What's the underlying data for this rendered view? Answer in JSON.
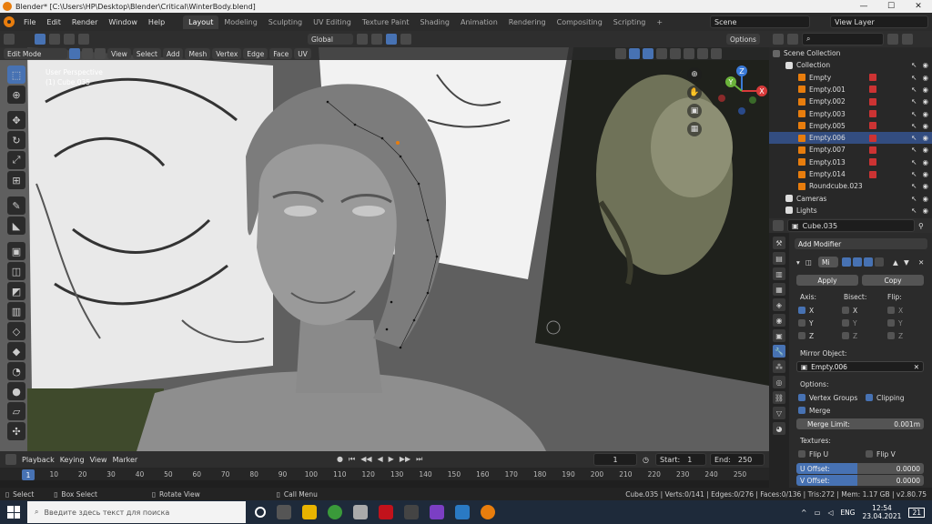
{
  "window": {
    "title": "Blender* [C:\\Users\\HP\\Desktop\\Blender\\Critical\\WinterBody.blend]",
    "controls": [
      "—",
      "☐",
      "✕"
    ]
  },
  "menubar": {
    "menus": [
      "File",
      "Edit",
      "Render",
      "Window",
      "Help"
    ],
    "workspaces": [
      "Layout",
      "Modeling",
      "Sculpting",
      "UV Editing",
      "Texture Paint",
      "Shading",
      "Animation",
      "Rendering",
      "Compositing",
      "Scripting"
    ],
    "active_workspace": "Layout",
    "add_tab": "+",
    "scene": "Scene",
    "view_layer": "View Layer"
  },
  "viewport_header": {
    "transform_orientation": "Global",
    "options": "Options",
    "mode": "Edit Mode",
    "menus": [
      "View",
      "Select",
      "Add",
      "Mesh",
      "Vertex",
      "Edge",
      "Face",
      "UV"
    ]
  },
  "viewport": {
    "perspective": "User Perspective",
    "object": "(1) Cube.035"
  },
  "gizmo": {
    "x": "X",
    "y": "Y",
    "z": "Z"
  },
  "timeline": {
    "menus": [
      "Playback",
      "Keying",
      "View",
      "Marker"
    ],
    "current_frame": "1",
    "start_label": "Start:",
    "start": "1",
    "end_label": "End:",
    "end": "250",
    "frames": [
      "1",
      "10",
      "20",
      "30",
      "40",
      "50",
      "60",
      "70",
      "80",
      "90",
      "100",
      "110",
      "120",
      "130",
      "140",
      "150",
      "160",
      "170",
      "180",
      "190",
      "200",
      "210",
      "220",
      "230",
      "240",
      "250"
    ]
  },
  "statusbar": {
    "select": "Select",
    "box_select": "Box Select",
    "rotate_view": "Rotate View",
    "call_menu": "Call Menu",
    "stats": "Cube.035 | Verts:0/141 | Edges:0/276 | Faces:0/136 | Tris:272 | Mem: 1.17 GB | v2.80.75"
  },
  "outliner": {
    "root": "Scene Collection",
    "items": [
      {
        "label": "Collection",
        "level": 1,
        "selected": false,
        "type": "collection"
      },
      {
        "label": "Empty",
        "level": 2,
        "selected": false,
        "type": "empty"
      },
      {
        "label": "Empty.001",
        "level": 2,
        "selected": false,
        "type": "empty"
      },
      {
        "label": "Empty.002",
        "level": 2,
        "selected": false,
        "type": "empty"
      },
      {
        "label": "Empty.003",
        "level": 2,
        "selected": false,
        "type": "empty"
      },
      {
        "label": "Empty.005",
        "level": 2,
        "selected": false,
        "type": "empty"
      },
      {
        "label": "Empty.006",
        "level": 2,
        "selected": true,
        "type": "empty"
      },
      {
        "label": "Empty.007",
        "level": 2,
        "selected": false,
        "type": "empty"
      },
      {
        "label": "Empty.013",
        "level": 2,
        "selected": false,
        "type": "empty"
      },
      {
        "label": "Empty.014",
        "level": 2,
        "selected": false,
        "type": "empty"
      },
      {
        "label": "Roundcube.023",
        "level": 2,
        "selected": false,
        "type": "mesh"
      },
      {
        "label": "Cameras",
        "level": 1,
        "selected": false,
        "type": "collection"
      },
      {
        "label": "Lights",
        "level": 1,
        "selected": false,
        "type": "collection"
      }
    ]
  },
  "properties": {
    "object": "Cube.035",
    "add_modifier": "Add Modifier",
    "modifier_name": "Mi",
    "apply": "Apply",
    "copy": "Copy",
    "axis_label": "Axis:",
    "bisect_label": "Bisect:",
    "flip_label": "Flip:",
    "axes": [
      "X",
      "Y",
      "Z"
    ],
    "mirror_object_label": "Mirror Object:",
    "mirror_object": "Empty.006",
    "options_label": "Options:",
    "vertex_groups": "Vertex Groups",
    "clipping": "Clipping",
    "merge": "Merge",
    "merge_limit_label": "Merge Limit:",
    "merge_limit": "0.001m",
    "textures_label": "Textures:",
    "flip_u": "Flip U",
    "flip_v": "Flip V",
    "u_offset_label": "U Offset:",
    "u_offset": "0.0000",
    "v_offset_label": "V Offset:",
    "v_offset": "0.0000"
  },
  "taskbar": {
    "search_placeholder": "Введите здесь текст для поиска",
    "lang": "ENG",
    "time": "12:54",
    "date": "23.04.2021",
    "notifications": "21"
  }
}
